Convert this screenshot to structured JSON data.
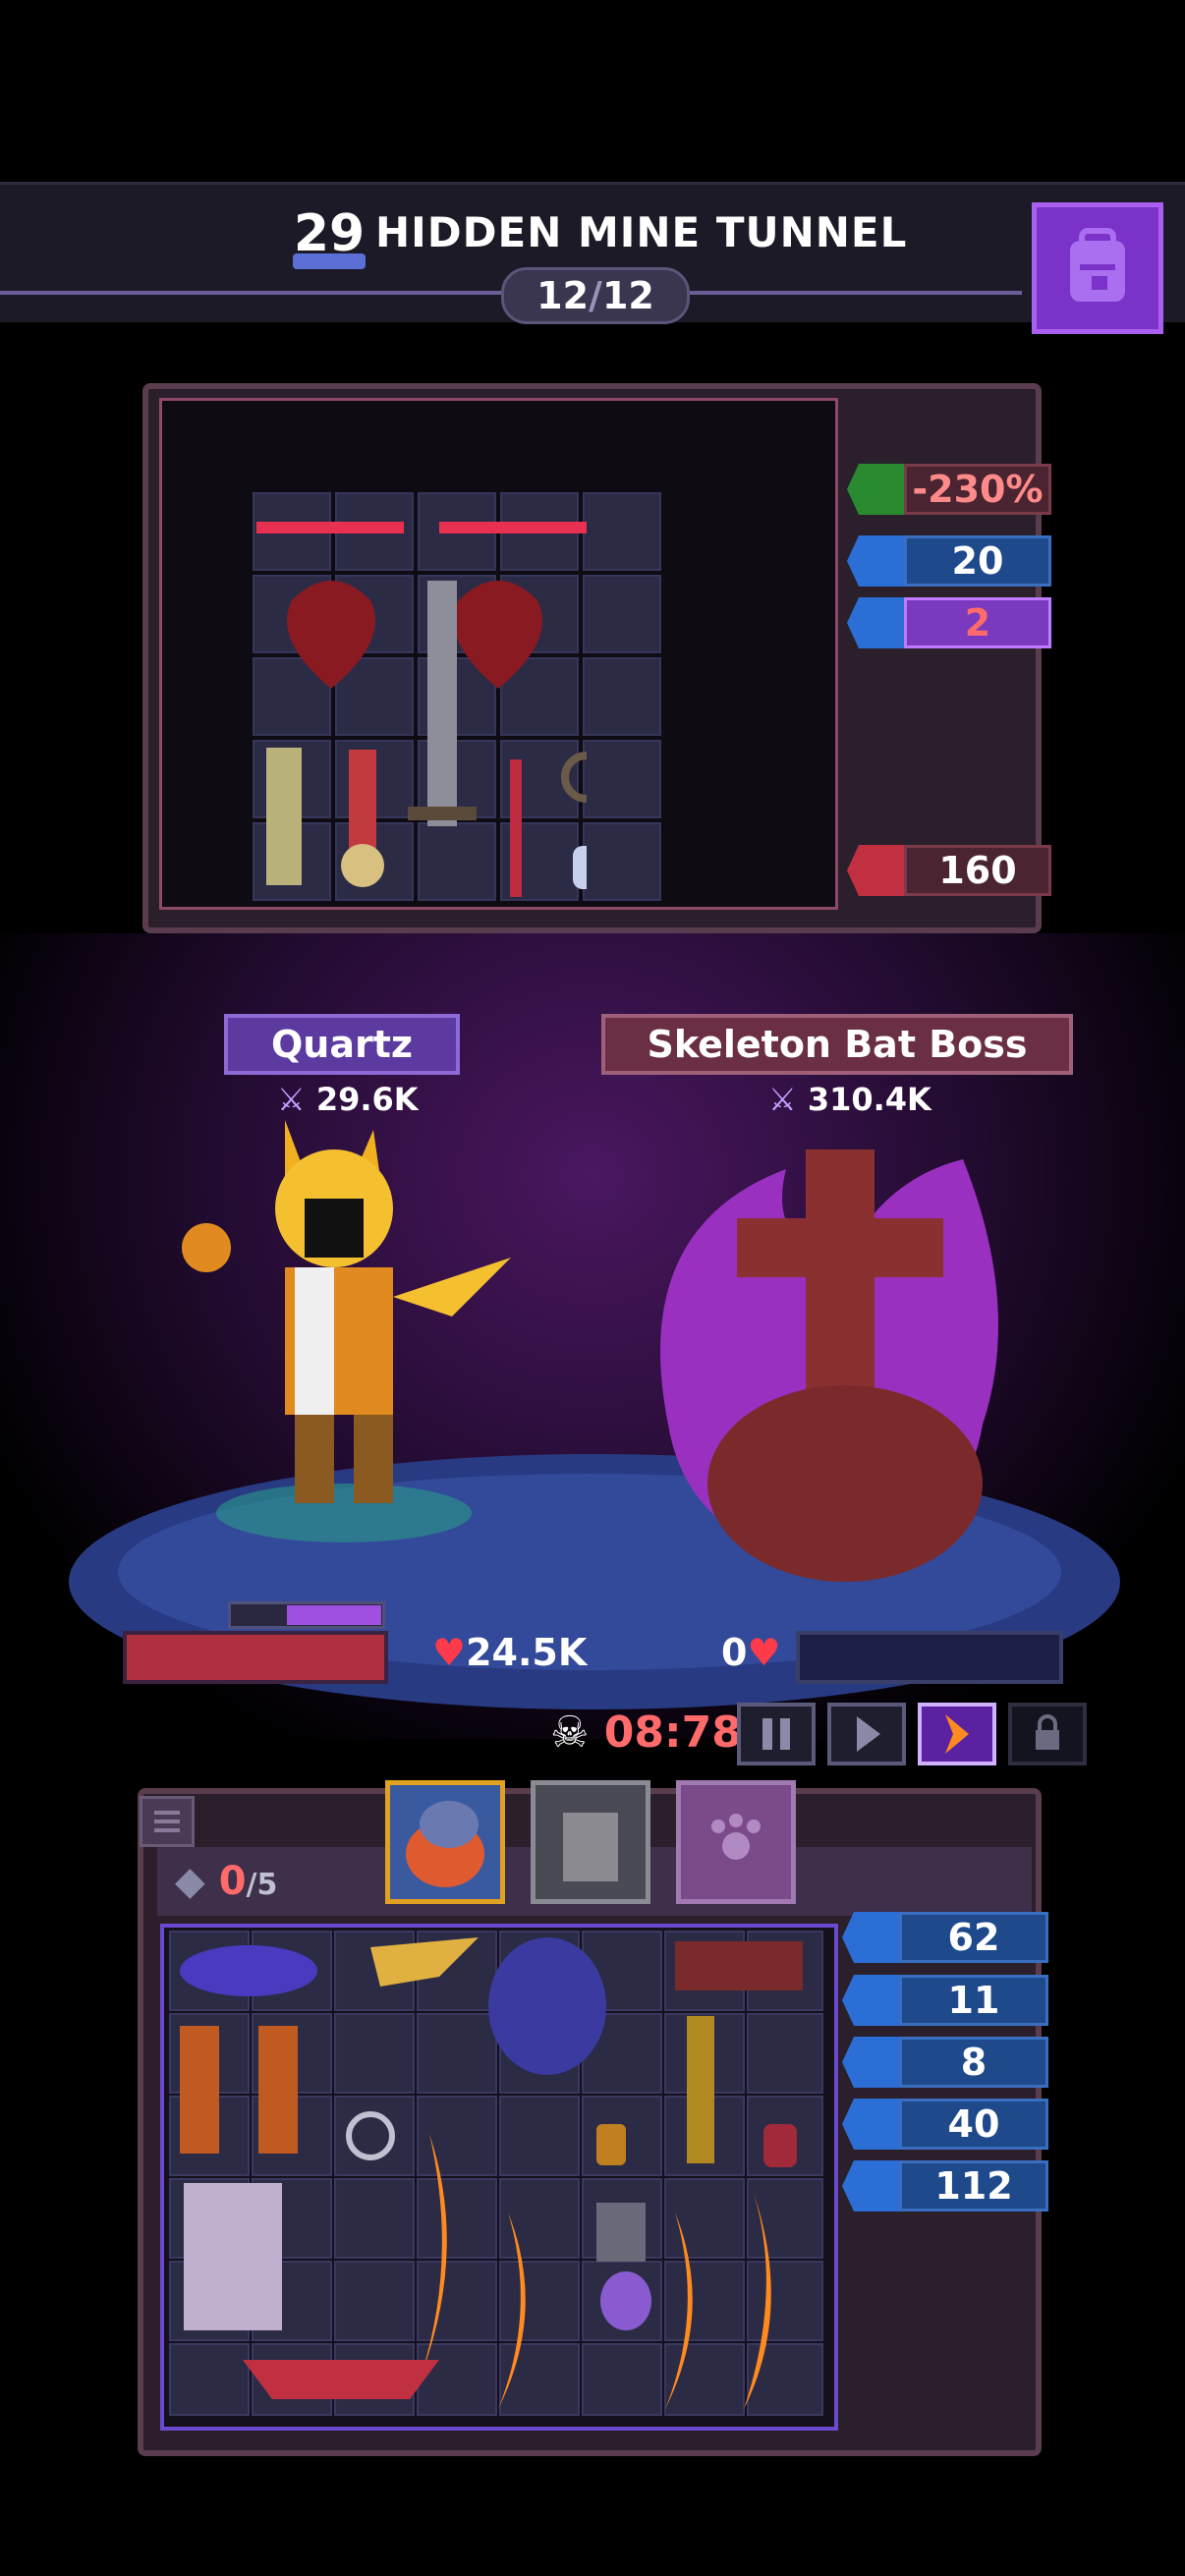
{
  "header": {
    "level": "29",
    "area_name": "HIDDEN MINE TUNNEL",
    "wave_current": "12",
    "wave_separator": "/",
    "wave_total": "12",
    "backpack_icon": "backpack-icon"
  },
  "boss_panel": {
    "stats": [
      {
        "icon": "crit-slash-icon",
        "value": "-230%",
        "color": "#4a2430"
      },
      {
        "icon": "demon-mask-icon",
        "value": "20",
        "color": "#1e4a8c"
      },
      {
        "icon": "skull-icon",
        "value": "2",
        "color": "#7a3ac0"
      },
      {
        "icon": "fire-heart-icon",
        "value": "160",
        "color": "#4a2430"
      }
    ]
  },
  "battle": {
    "hero_name": "Quartz",
    "hero_power": "29.6K",
    "boss_name": "Skeleton Bat Boss",
    "boss_power": "310.4K",
    "hero_hp": "24.5K",
    "boss_hp": "0",
    "timer": "08:78"
  },
  "inventory": {
    "slots_used": "0",
    "slots_sep": "/",
    "slots_total": "5",
    "stats": [
      {
        "icon": "scroll-icon",
        "value": "62"
      },
      {
        "icon": "crossed-swords-icon",
        "value": "11"
      },
      {
        "icon": "demon-mask-icon",
        "value": "8"
      },
      {
        "icon": "target-icon",
        "value": "40"
      },
      {
        "icon": "boot-icon",
        "value": "112"
      }
    ]
  },
  "colors": {
    "accent_purple": "#7a32c9",
    "hp_red": "#b03040",
    "timer_red": "#ff6a6a",
    "stat_blue": "#1e4a8c"
  }
}
